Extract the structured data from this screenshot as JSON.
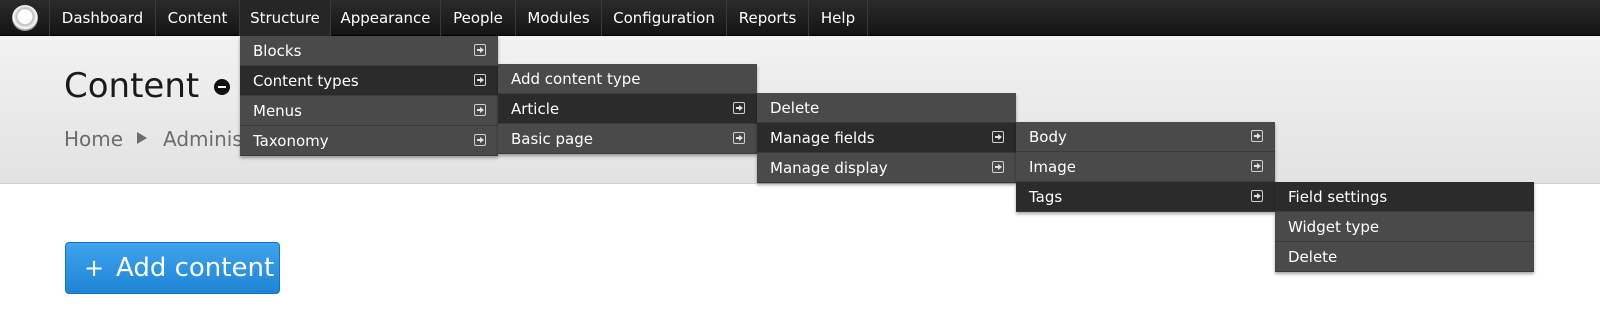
{
  "toolbar": {
    "items": [
      {
        "label": "Dashboard"
      },
      {
        "label": "Content"
      },
      {
        "label": "Structure"
      },
      {
        "label": "Appearance"
      },
      {
        "label": "People"
      },
      {
        "label": "Modules"
      },
      {
        "label": "Configuration"
      },
      {
        "label": "Reports"
      },
      {
        "label": "Help"
      }
    ]
  },
  "page": {
    "title": "Content",
    "breadcrumb": [
      "Home",
      "Administration"
    ]
  },
  "add_button": {
    "icon": "+",
    "label": "Add content"
  },
  "menus": {
    "structure": [
      {
        "label": "Blocks"
      },
      {
        "label": "Content types"
      },
      {
        "label": "Menus"
      },
      {
        "label": "Taxonomy"
      }
    ],
    "content_types": [
      {
        "label": "Add content type"
      },
      {
        "label": "Article"
      },
      {
        "label": "Basic page"
      }
    ],
    "article": [
      {
        "label": "Delete"
      },
      {
        "label": "Manage fields"
      },
      {
        "label": "Manage display"
      }
    ],
    "manage_fields": [
      {
        "label": "Body"
      },
      {
        "label": "Image"
      },
      {
        "label": "Tags"
      }
    ],
    "tags": [
      {
        "label": "Field settings"
      },
      {
        "label": "Widget type"
      },
      {
        "label": "Delete"
      }
    ]
  }
}
